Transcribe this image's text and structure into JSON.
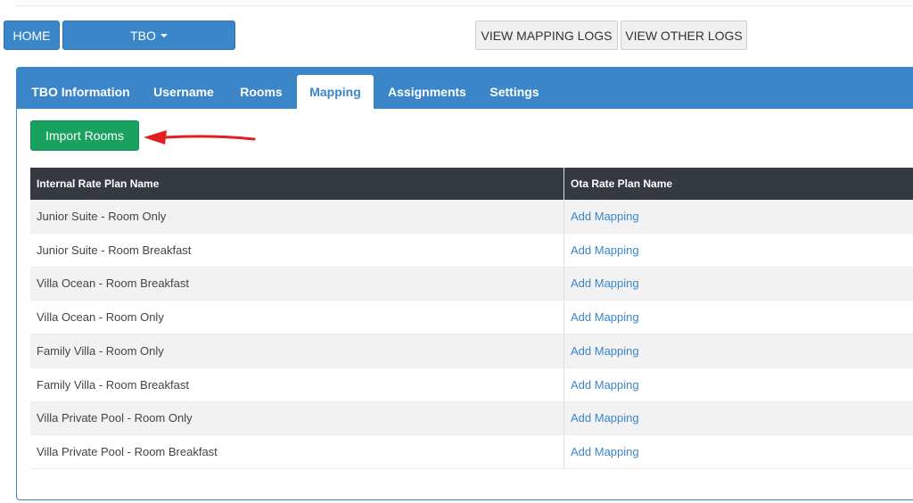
{
  "nav": {
    "home": "HOME",
    "tbo": "TBO",
    "view_mapping_logs": "VIEW MAPPING LOGS",
    "view_other_logs": "VIEW OTHER LOGS"
  },
  "tabs": [
    {
      "label": "TBO Information"
    },
    {
      "label": "Username"
    },
    {
      "label": "Rooms"
    },
    {
      "label": "Mapping"
    },
    {
      "label": "Assignments"
    },
    {
      "label": "Settings"
    }
  ],
  "import_button": "Import Rooms",
  "table": {
    "headers": [
      "Internal Rate Plan Name",
      "Ota Rate Plan Name"
    ],
    "rows": [
      {
        "name": "Junior Suite - Room Only",
        "action": "Add Mapping"
      },
      {
        "name": "Junior Suite - Room Breakfast",
        "action": "Add Mapping"
      },
      {
        "name": "Villa Ocean - Room Breakfast",
        "action": "Add Mapping"
      },
      {
        "name": "Villa Ocean - Room Only",
        "action": "Add Mapping"
      },
      {
        "name": "Family Villa - Room Only",
        "action": "Add Mapping"
      },
      {
        "name": "Family Villa - Room Breakfast",
        "action": "Add Mapping"
      },
      {
        "name": "Villa Private Pool - Room Only",
        "action": "Add Mapping"
      },
      {
        "name": "Villa Private Pool - Room Breakfast",
        "action": "Add Mapping"
      }
    ]
  },
  "colors": {
    "primary": "#3a86c8",
    "success": "#19a15f",
    "header_dark": "#343a40",
    "arrow": "#e02020"
  }
}
